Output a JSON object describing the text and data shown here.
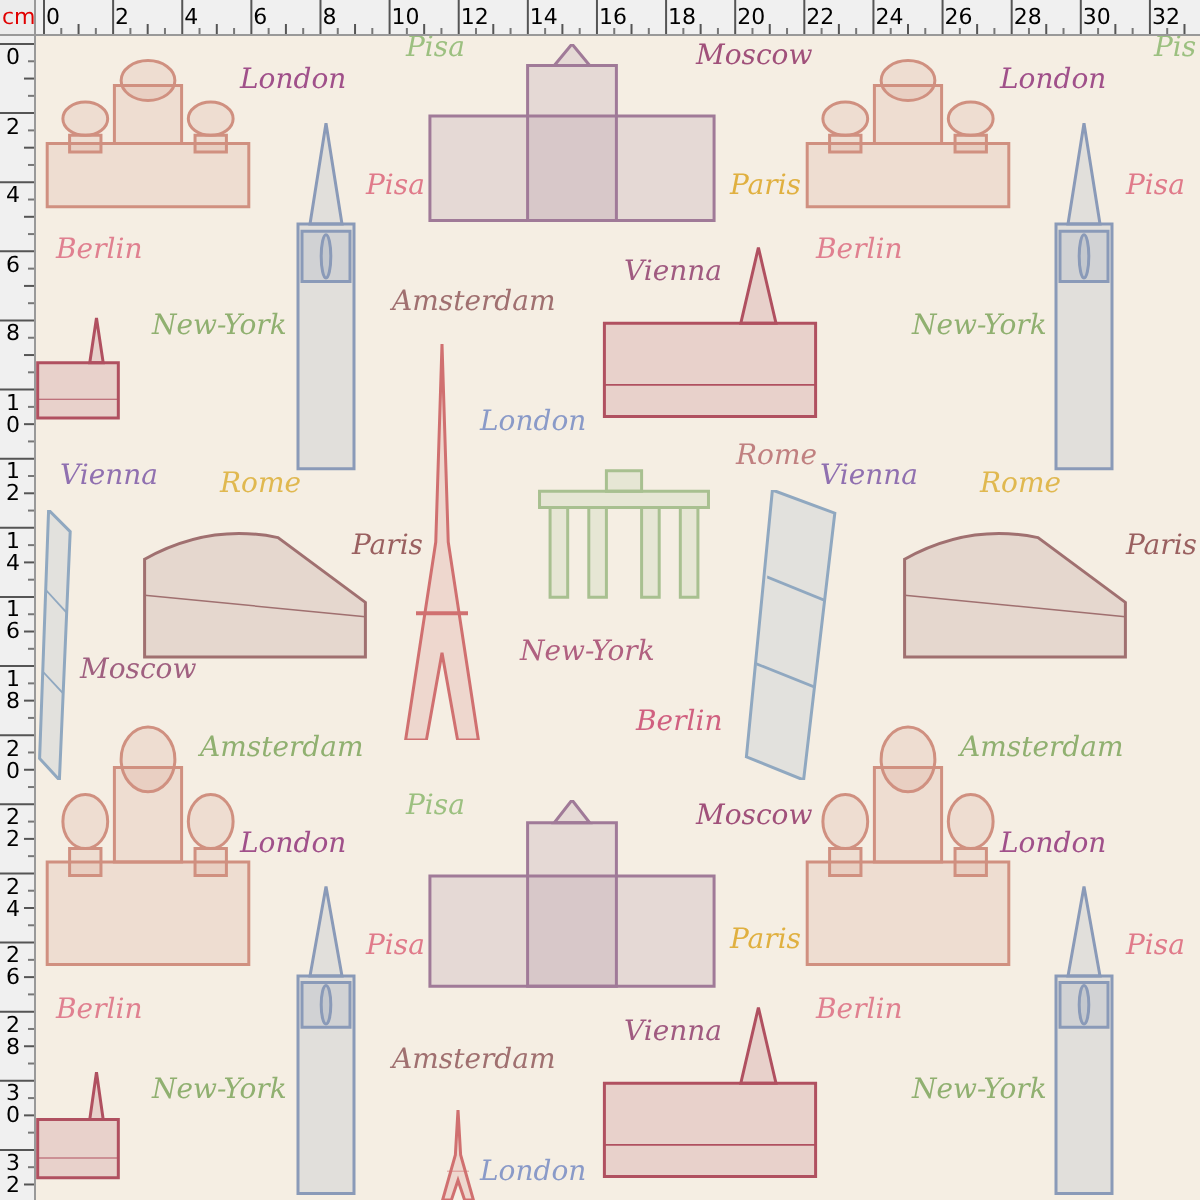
{
  "ruler": {
    "unit": "cm",
    "top_labels": [
      "0",
      "2",
      "4",
      "6",
      "8",
      "10",
      "12",
      "14",
      "16",
      "18",
      "20",
      "22",
      "24",
      "26",
      "28",
      "30",
      "32"
    ],
    "left_labels": [
      "0",
      "2",
      "4",
      "6",
      "8",
      "10",
      "12",
      "14",
      "16",
      "18",
      "20",
      "22",
      "24",
      "26",
      "28",
      "30",
      "32"
    ]
  },
  "fabric": {
    "labels": [
      {
        "text": "Pisa",
        "color": "#9cc080"
      },
      {
        "text": "London",
        "color": "#a0508a"
      },
      {
        "text": "Moscow",
        "color": "#a0507a"
      },
      {
        "text": "London",
        "color": "#a0508a"
      },
      {
        "text": "Pis",
        "color": "#9cc080"
      },
      {
        "text": "Pisa",
        "color": "#e07a8a"
      },
      {
        "text": "Paris",
        "color": "#e0b040"
      },
      {
        "text": "Pisa",
        "color": "#e07a8a"
      },
      {
        "text": "Berlin",
        "color": "#e08090"
      },
      {
        "text": "Vienna",
        "color": "#a05a80"
      },
      {
        "text": "Berlin",
        "color": "#e08090"
      },
      {
        "text": "Amsterdam",
        "color": "#a07070"
      },
      {
        "text": "New-York",
        "color": "#90b070"
      },
      {
        "text": "New-York",
        "color": "#90b070"
      },
      {
        "text": "London",
        "color": "#8a9ac8"
      },
      {
        "text": "Vienna",
        "color": "#9070b0"
      },
      {
        "text": "Rome",
        "color": "#e0b850"
      },
      {
        "text": "Rome",
        "color": "#c08080"
      },
      {
        "text": "Vienna",
        "color": "#9070b0"
      },
      {
        "text": "Rome",
        "color": "#e0b850"
      },
      {
        "text": "Paris",
        "color": "#9a6060"
      },
      {
        "text": "Paris",
        "color": "#9a6060"
      },
      {
        "text": "New-York",
        "color": "#b06080"
      },
      {
        "text": "Moscow",
        "color": "#a06080"
      },
      {
        "text": "Berlin",
        "color": "#d06080"
      },
      {
        "text": "Amsterdam",
        "color": "#90b070"
      },
      {
        "text": "Amsterdam",
        "color": "#90b070"
      },
      {
        "text": "Pisa",
        "color": "#9cc080"
      },
      {
        "text": "Moscow",
        "color": "#a0507a"
      },
      {
        "text": "London",
        "color": "#a0508a"
      },
      {
        "text": "London",
        "color": "#a0508a"
      },
      {
        "text": "Pisa",
        "color": "#e07a8a"
      },
      {
        "text": "Paris",
        "color": "#e0b040"
      },
      {
        "text": "Pisa",
        "color": "#e07a8a"
      },
      {
        "text": "Berlin",
        "color": "#e08090"
      },
      {
        "text": "Vienna",
        "color": "#a05a80"
      },
      {
        "text": "Berlin",
        "color": "#e08090"
      },
      {
        "text": "Amsterdam",
        "color": "#a07070"
      },
      {
        "text": "New-York",
        "color": "#90b070"
      },
      {
        "text": "New-York",
        "color": "#90b070"
      },
      {
        "text": "London",
        "color": "#8a9ac8"
      }
    ]
  }
}
